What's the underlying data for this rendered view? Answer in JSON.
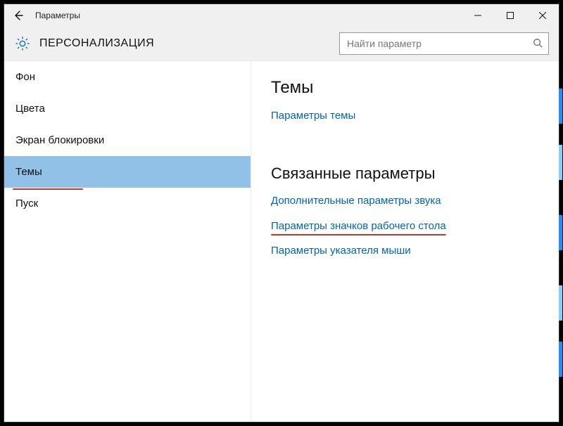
{
  "window": {
    "title": "Параметры"
  },
  "header": {
    "category": "ПЕРСОНАЛИЗАЦИЯ"
  },
  "search": {
    "placeholder": "Найти параметр"
  },
  "sidebar": {
    "items": [
      {
        "label": "Фон",
        "selected": false
      },
      {
        "label": "Цвета",
        "selected": false
      },
      {
        "label": "Экран блокировки",
        "selected": false
      },
      {
        "label": "Темы",
        "selected": true
      },
      {
        "label": "Пуск",
        "selected": false
      }
    ]
  },
  "content": {
    "heading1": "Темы",
    "link_theme_settings": "Параметры темы",
    "heading2": "Связанные параметры",
    "link_sound": "Дополнительные параметры звука",
    "link_desktop_icons": "Параметры значков рабочего стола",
    "link_pointer": "Параметры указателя мыши"
  }
}
